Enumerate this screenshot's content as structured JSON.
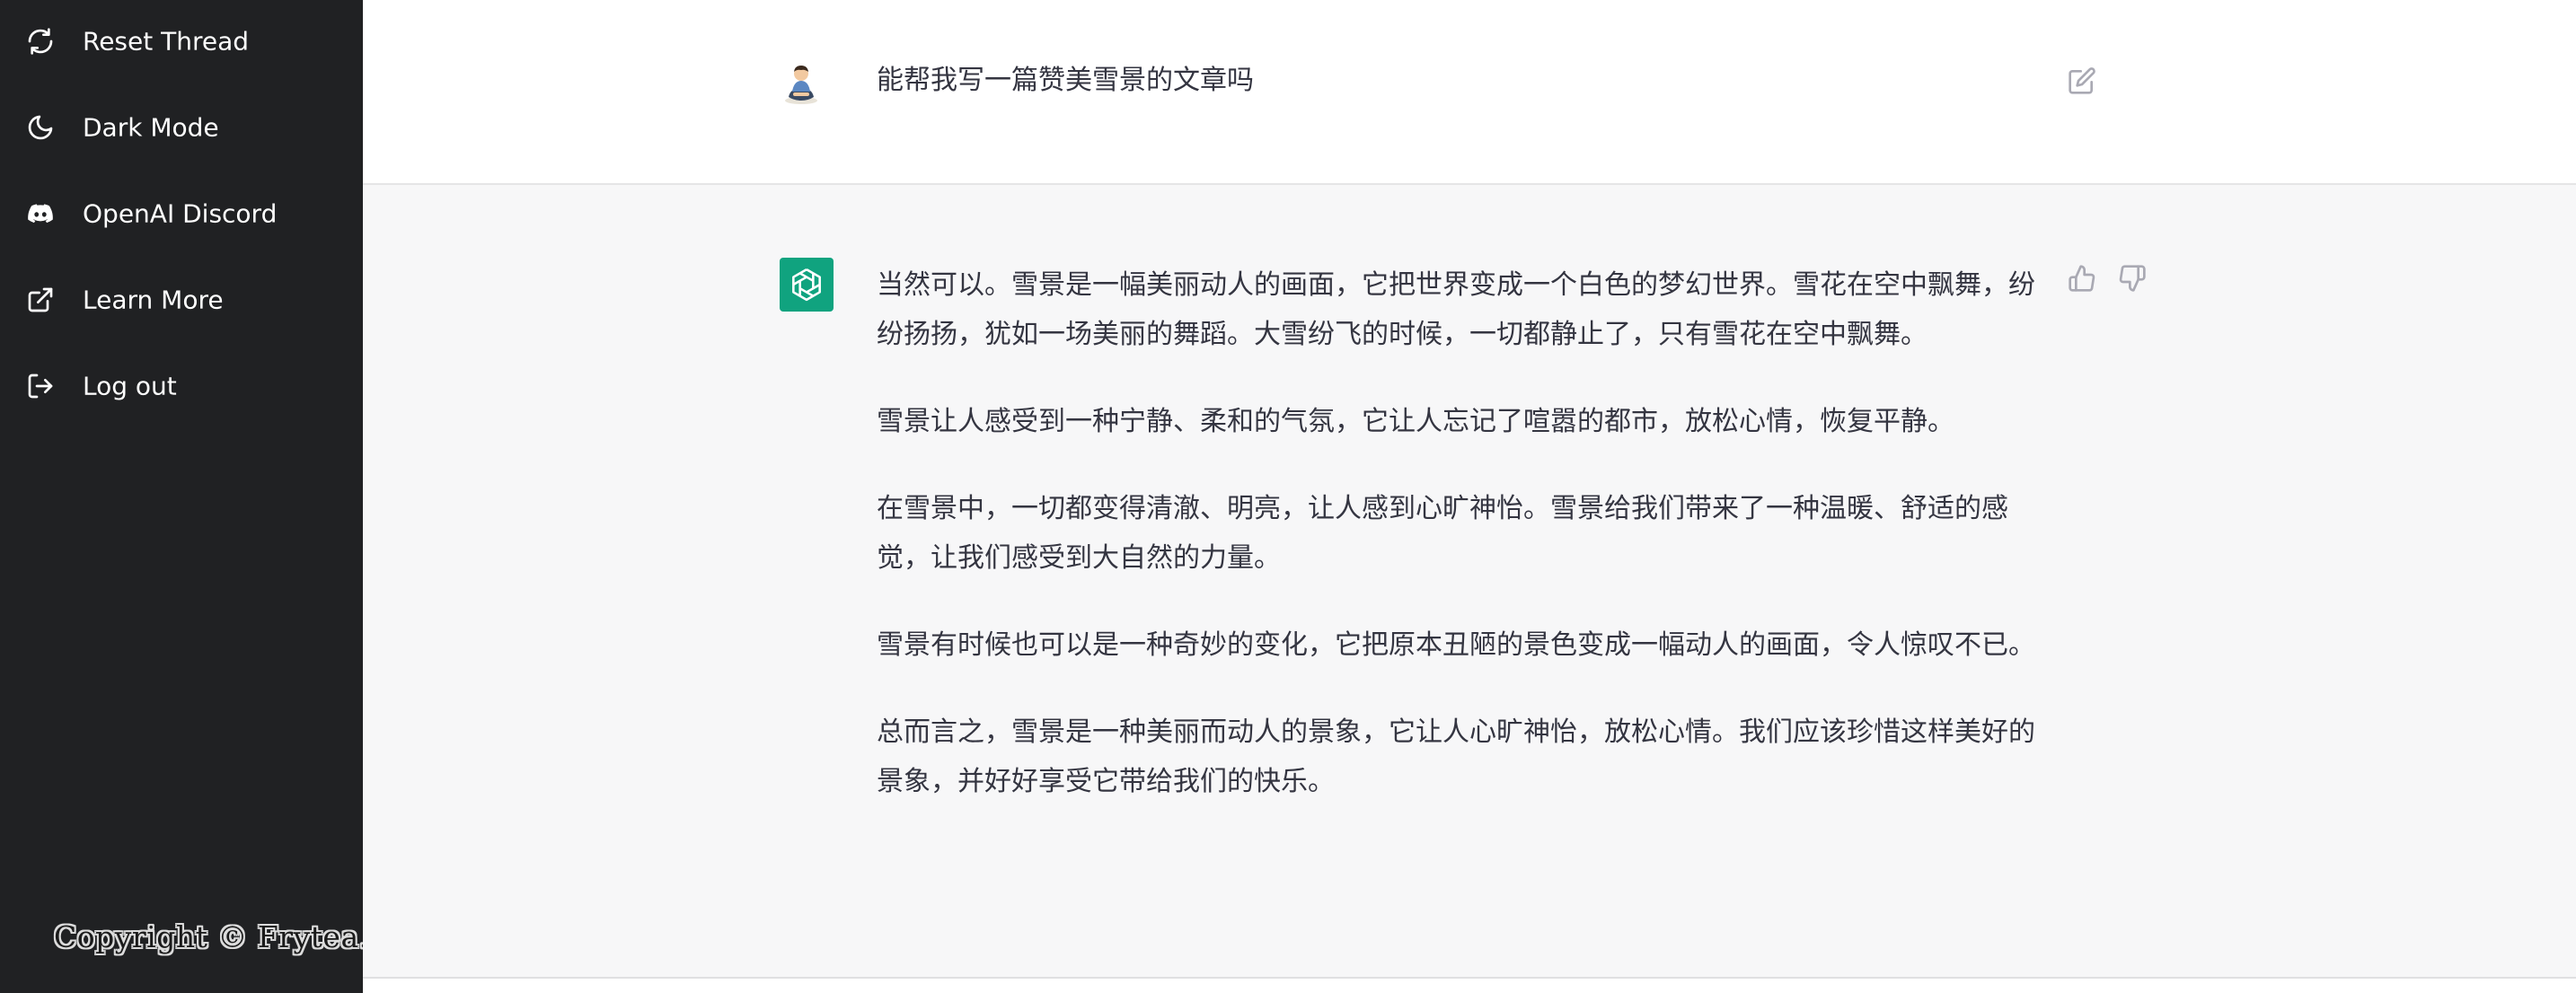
{
  "sidebar": {
    "items": [
      {
        "label": "Reset Thread",
        "icon": "refresh-icon"
      },
      {
        "label": "Dark Mode",
        "icon": "moon-icon"
      },
      {
        "label": "OpenAI Discord",
        "icon": "discord-icon"
      },
      {
        "label": "Learn More",
        "icon": "external-link-icon"
      },
      {
        "label": "Log out",
        "icon": "logout-icon"
      }
    ],
    "copyright": "Copyright © Frytea.Com"
  },
  "conversation": {
    "user_message": "能帮我写一篇赞美雪景的文章吗",
    "assistant_paragraphs": [
      "当然可以。雪景是一幅美丽动人的画面，它把世界变成一个白色的梦幻世界。雪花在空中飘舞，纷纷扬扬，犹如一场美丽的舞蹈。大雪纷飞的时候，一切都静止了，只有雪花在空中飘舞。",
      "雪景让人感受到一种宁静、柔和的气氛，它让人忘记了喧嚣的都市，放松心情，恢复平静。",
      "在雪景中，一切都变得清澈、明亮，让人感到心旷神怡。雪景给我们带来了一种温暖、舒适的感觉，让我们感受到大自然的力量。",
      "雪景有时候也可以是一种奇妙的变化，它把原本丑陋的景色变成一幅动人的画面，令人惊叹不已。",
      "总而言之，雪景是一种美丽而动人的景象，它让人心旷神怡，放松心情。我们应该珍惜这样美好的景象，并好好享受它带给我们的快乐。"
    ]
  },
  "colors": {
    "sidebar_bg": "#202123",
    "assistant_bg": "#f7f7f8",
    "bot_avatar": "#10a37f",
    "text": "#343541"
  }
}
